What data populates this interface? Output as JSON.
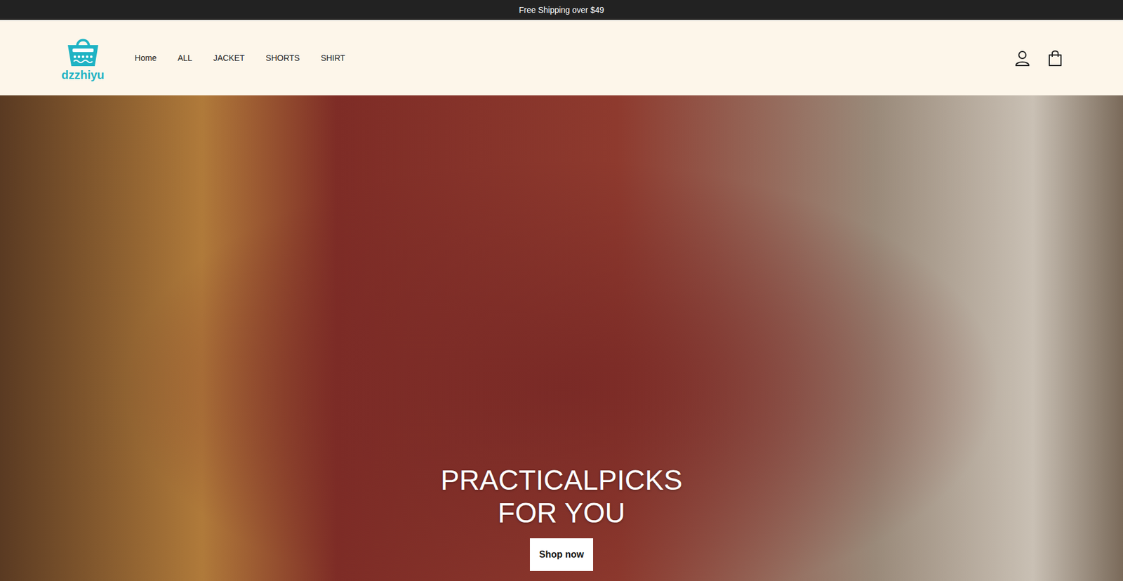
{
  "announcement": {
    "text": "Free Shipping over $49"
  },
  "header": {
    "logo": {
      "text": "dzzhiyu"
    },
    "nav": [
      {
        "label": "Home"
      },
      {
        "label": "ALL"
      },
      {
        "label": "JACKET"
      },
      {
        "label": "SHORTS"
      },
      {
        "label": "SHIRT"
      }
    ]
  },
  "hero": {
    "heading_lines": [
      "PRACTICALPICKS",
      "FOR YOU"
    ],
    "button": "Shop now"
  }
}
